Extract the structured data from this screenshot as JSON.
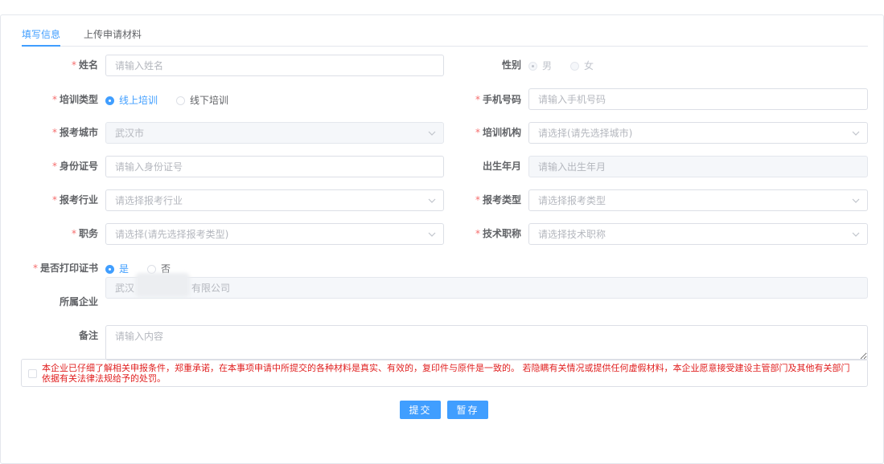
{
  "tabs": [
    {
      "label": "填写信息",
      "active": true
    },
    {
      "label": "上传申请材料",
      "active": false
    }
  ],
  "form": {
    "name": {
      "label": "姓名",
      "required": true,
      "placeholder": "请输入姓名"
    },
    "gender": {
      "label": "性别",
      "options": [
        "男",
        "女"
      ],
      "selected": "男",
      "disabled": true
    },
    "training_type": {
      "label": "培训类型",
      "required": true,
      "options": [
        "线上培训",
        "线下培训"
      ],
      "selected": "线上培训"
    },
    "phone": {
      "label": "手机号码",
      "required": true,
      "placeholder": "请输入手机号码"
    },
    "city": {
      "label": "报考城市",
      "required": true,
      "value": "武汉市",
      "disabled": true
    },
    "institution": {
      "label": "培训机构",
      "required": true,
      "placeholder": "请选择(请先选择城市)"
    },
    "id_number": {
      "label": "身份证号",
      "required": true,
      "placeholder": "请输入身份证号"
    },
    "birth": {
      "label": "出生年月",
      "required": false,
      "placeholder": "请输入出生年月",
      "disabled": true
    },
    "industry": {
      "label": "报考行业",
      "required": true,
      "placeholder": "请选择报考行业"
    },
    "exam_type": {
      "label": "报考类型",
      "required": true,
      "placeholder": "请选择报考类型"
    },
    "position": {
      "label": "职务",
      "required": true,
      "placeholder": "请选择(请先选择报考类型)"
    },
    "tech_title": {
      "label": "技术职称",
      "required": true,
      "placeholder": "请选择技术职称"
    },
    "print_cert": {
      "label": "是否打印证书",
      "required": true,
      "options": [
        "是",
        "否"
      ],
      "selected": "是"
    },
    "company": {
      "label": "所属企业",
      "value_prefix": "武汉",
      "value_suffix": "有限公司",
      "disabled": true
    },
    "remark": {
      "label": "备注",
      "placeholder": "请输入内容"
    }
  },
  "notice": {
    "text": "本企业已仔细了解相关申报条件，郑重承诺，在本事项申请中所提交的各种材料是真实、有效的，复印件与原件是一致的。 若隐瞒有关情况或提供任何虚假材料，本企业愿意接受建设主管部门及其他有关部门依据有关法律法规给予的处罚。",
    "checked": false,
    "color": "#e02020"
  },
  "buttons": {
    "submit": "提交",
    "save": "暂存"
  },
  "colors": {
    "accent": "#409eff",
    "required": "#f56c6c",
    "border": "#dcdfe6"
  }
}
